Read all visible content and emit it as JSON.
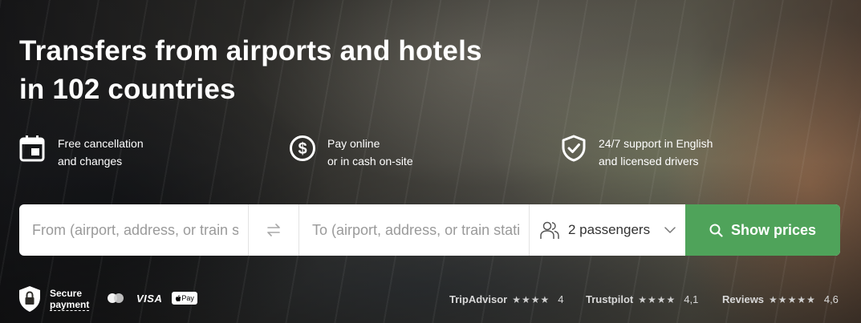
{
  "hero": {
    "title_line1": "Transfers from airports and hotels",
    "title_line2": "in 102 countries"
  },
  "features": [
    {
      "icon": "calendar-icon",
      "line1": "Free cancellation",
      "line2": "and changes"
    },
    {
      "icon": "dollar-coin-icon",
      "line1": "Pay online",
      "line2": "or in cash on-site"
    },
    {
      "icon": "shield-check-icon",
      "line1": "24/7 support in English",
      "line2": "and licensed drivers"
    }
  ],
  "search": {
    "from_placeholder": "From (airport, address, or train station)",
    "to_placeholder": "To (airport, address, or train station)",
    "passengers": "2 passengers",
    "button_label": "Show prices"
  },
  "secure": {
    "line1": "Secure",
    "line2": "payment"
  },
  "payment_methods": {
    "visa": "VISA",
    "apple_pay": "Pay"
  },
  "ratings": [
    {
      "name": "TripAdvisor",
      "stars": "★★★★",
      "score": "4"
    },
    {
      "name": "Trustpilot",
      "stars": "★★★★",
      "score": "4,1"
    },
    {
      "name": "Reviews",
      "stars": "★★★★★",
      "score": "4,6"
    }
  ],
  "colors": {
    "accent_green": "#4fa35a",
    "white": "#ffffff"
  }
}
